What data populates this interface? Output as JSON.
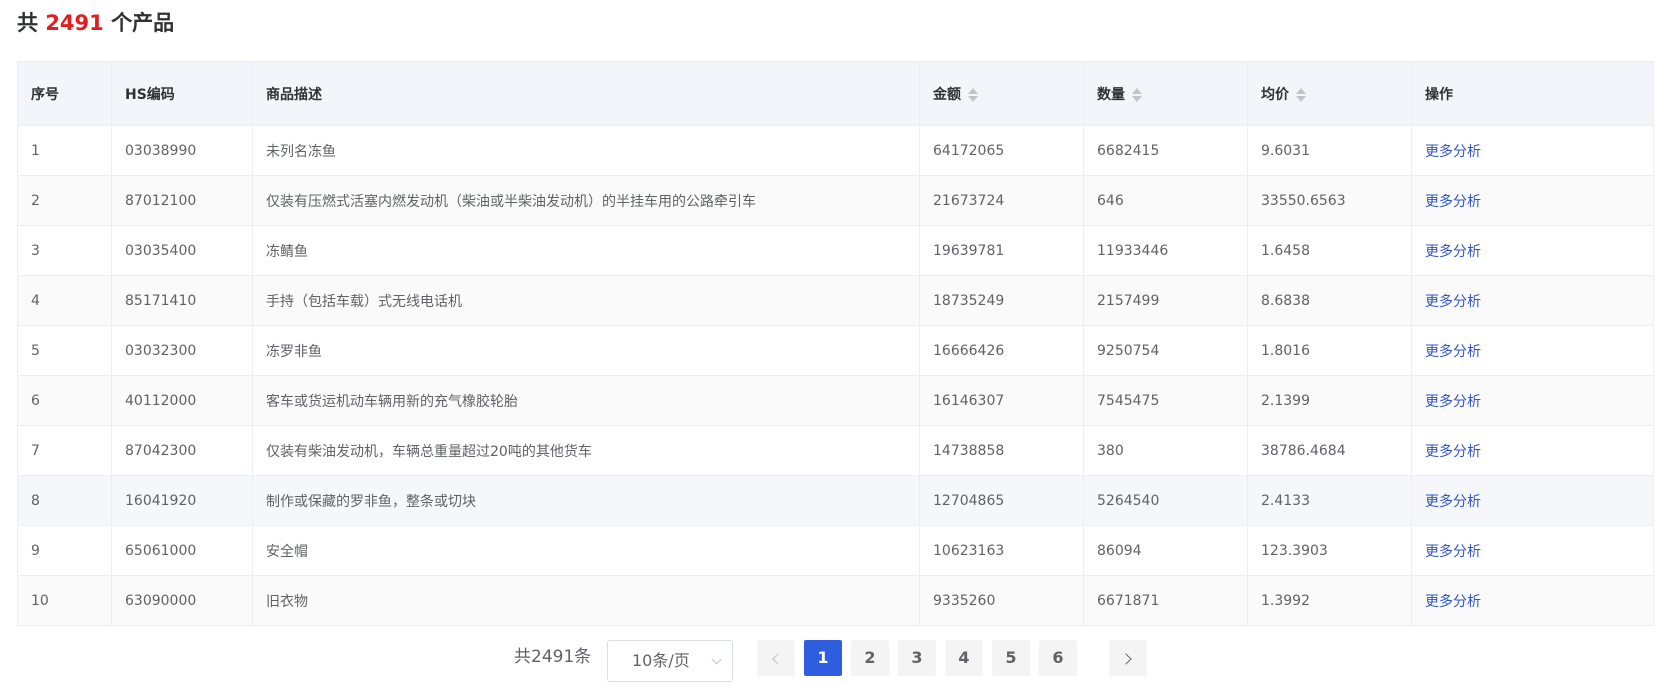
{
  "summary": {
    "prefix": "共",
    "count": "2491",
    "suffix": "个产品"
  },
  "colors": {
    "count_red": "#e02020",
    "link_blue": "#2f54c9",
    "active_page": "#2f5fe0",
    "header_bg": "#f2f6fa"
  },
  "table": {
    "columns": [
      {
        "label": "序号",
        "sortable": false
      },
      {
        "label": "HS编码",
        "sortable": false
      },
      {
        "label": "商品描述",
        "sortable": false
      },
      {
        "label": "金额",
        "sortable": true
      },
      {
        "label": "数量",
        "sortable": true
      },
      {
        "label": "均价",
        "sortable": true
      },
      {
        "label": "操作",
        "sortable": false
      }
    ],
    "action_label": "更多分析",
    "rows": [
      {
        "index": "1",
        "hs": "03038990",
        "desc": "未列名冻鱼",
        "amount": "64172065",
        "qty": "6682415",
        "avg": "9.6031"
      },
      {
        "index": "2",
        "hs": "87012100",
        "desc": "仅装有压燃式活塞内燃发动机（柴油或半柴油发动机）的半挂车用的公路牵引车",
        "amount": "21673724",
        "qty": "646",
        "avg": "33550.6563"
      },
      {
        "index": "3",
        "hs": "03035400",
        "desc": "冻鲭鱼",
        "amount": "19639781",
        "qty": "11933446",
        "avg": "1.6458"
      },
      {
        "index": "4",
        "hs": "85171410",
        "desc": "手持（包括车载）式无线电话机",
        "amount": "18735249",
        "qty": "2157499",
        "avg": "8.6838"
      },
      {
        "index": "5",
        "hs": "03032300",
        "desc": "冻罗非鱼",
        "amount": "16666426",
        "qty": "9250754",
        "avg": "1.8016"
      },
      {
        "index": "6",
        "hs": "40112000",
        "desc": "客车或货运机动车辆用新的充气橡胶轮胎",
        "amount": "16146307",
        "qty": "7545475",
        "avg": "2.1399"
      },
      {
        "index": "7",
        "hs": "87042300",
        "desc": "仅装有柴油发动机，车辆总重量超过20吨的其他货车",
        "amount": "14738858",
        "qty": "380",
        "avg": "38786.4684"
      },
      {
        "index": "8",
        "hs": "16041920",
        "desc": "制作或保藏的罗非鱼，整条或切块",
        "amount": "12704865",
        "qty": "5264540",
        "avg": "2.4133"
      },
      {
        "index": "9",
        "hs": "65061000",
        "desc": "安全帽",
        "amount": "10623163",
        "qty": "86094",
        "avg": "123.3903"
      },
      {
        "index": "10",
        "hs": "63090000",
        "desc": "旧衣物",
        "amount": "9335260",
        "qty": "6671871",
        "avg": "1.3992"
      }
    ]
  },
  "pagination": {
    "total_text": "共2491条",
    "page_size": "10条/页",
    "pages": [
      "1",
      "2",
      "3",
      "4",
      "5",
      "6"
    ],
    "current_page": "1"
  }
}
